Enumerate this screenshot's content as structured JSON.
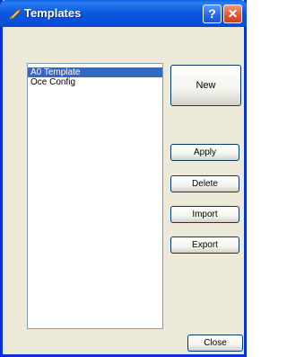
{
  "window": {
    "title": "Templates",
    "icon": "pencil-icon",
    "help_label": "?",
    "close_label": "✕"
  },
  "templates_list": {
    "items": [
      {
        "label": "A0 Template",
        "selected": true
      },
      {
        "label": "Oce Config",
        "selected": false
      }
    ]
  },
  "buttons": {
    "new_label": "New",
    "apply_label": "Apply",
    "delete_label": "Delete",
    "import_label": "Import",
    "export_label": "Export",
    "close_label": "Close"
  },
  "colors": {
    "titlebar": "#0b56e0",
    "window_border": "#0831d9",
    "dialog_bg": "#ece9d8",
    "selection": "#316ac5",
    "close_button": "#e2542c"
  }
}
